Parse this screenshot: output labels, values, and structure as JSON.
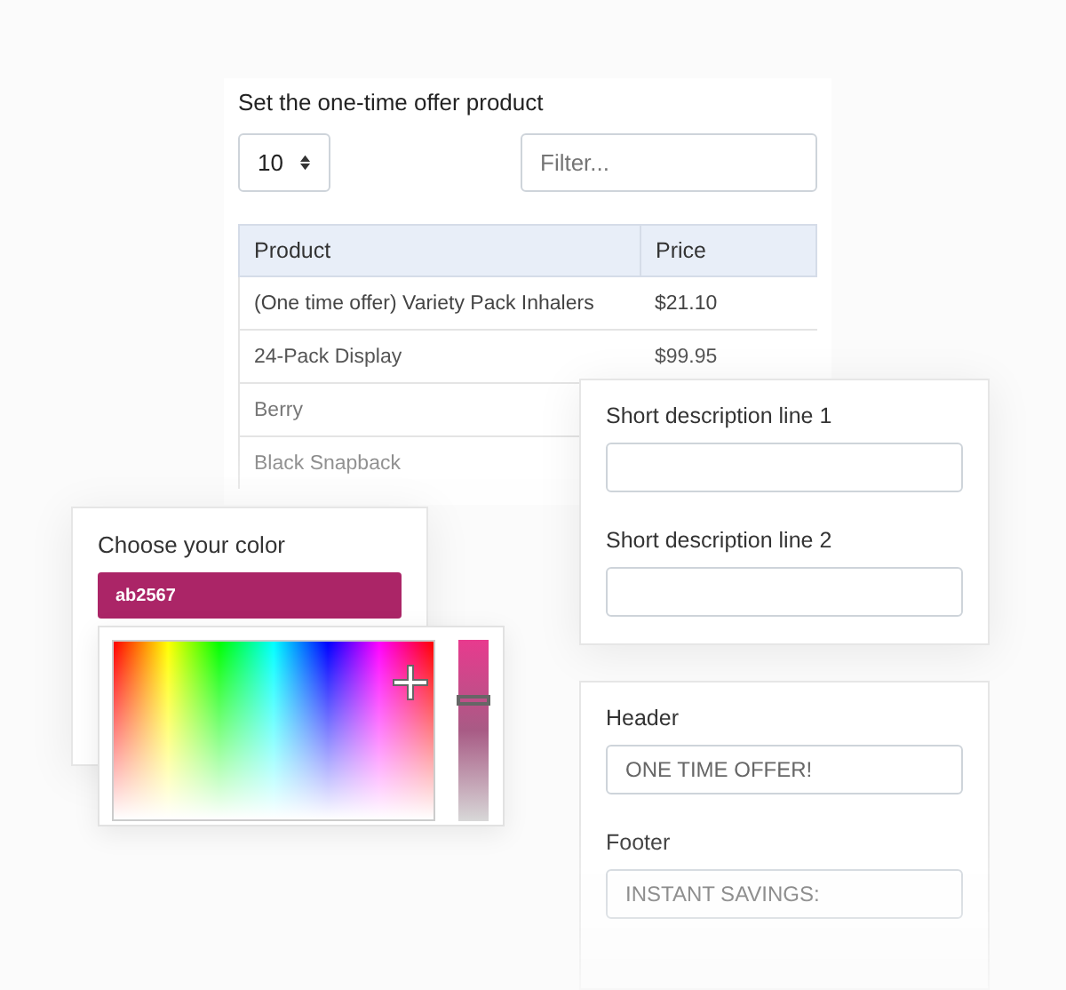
{
  "product_card": {
    "title": "Set the one-time offer product",
    "page_size": {
      "value": "10"
    },
    "filter": {
      "placeholder": "Filter..."
    },
    "table": {
      "columns": [
        "Product",
        "Price"
      ],
      "rows": [
        {
          "product": "(One time offer) Variety Pack Inhalers",
          "price": "$21.10"
        },
        {
          "product": "24-Pack Display",
          "price": "$99.95"
        },
        {
          "product": "Berry"
        },
        {
          "product": "Black Snapback"
        }
      ]
    }
  },
  "color_card": {
    "label": "Choose your color",
    "value": "ab2567",
    "color": "#ab2567",
    "shade": {
      "level": 0.67
    }
  },
  "description_card": {
    "fields": [
      {
        "label": "Short description line 1"
      },
      {
        "label": "Short description line 2"
      }
    ]
  },
  "text_card": {
    "fields": [
      {
        "label": "Header",
        "value": "ONE TIME OFFER!"
      },
      {
        "label": "Footer",
        "value": "INSTANT SAVINGS:"
      }
    ]
  }
}
